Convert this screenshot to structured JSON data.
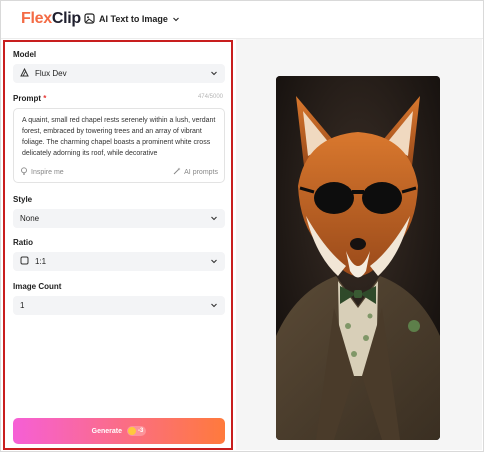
{
  "header": {
    "logo_part1": "Flex",
    "logo_part2": "Clip",
    "tool_label": "AI Text to Image"
  },
  "model": {
    "label": "Model",
    "value": "Flux Dev"
  },
  "prompt": {
    "label": "Prompt",
    "required_mark": "*",
    "counter": "474/5000",
    "text": "A quaint, small red chapel rests serenely within a lush, verdant forest, embraced by towering trees and an array of vibrant foliage. The charming chapel boasts a prominent white cross delicately adorning its roof, while decorative",
    "inspire_label": "Inspire me",
    "ai_prompts_label": "AI prompts"
  },
  "style": {
    "label": "Style",
    "value": "None"
  },
  "ratio": {
    "label": "Ratio",
    "value": "1:1"
  },
  "image_count": {
    "label": "Image Count",
    "value": "1"
  },
  "generate": {
    "label": "Generate",
    "cost": "-3"
  },
  "colors": {
    "panel_border": "#c81e1e",
    "generate_start": "#f65fd6",
    "generate_end": "#ff7a3c",
    "logo_accent": "#f46b45"
  }
}
